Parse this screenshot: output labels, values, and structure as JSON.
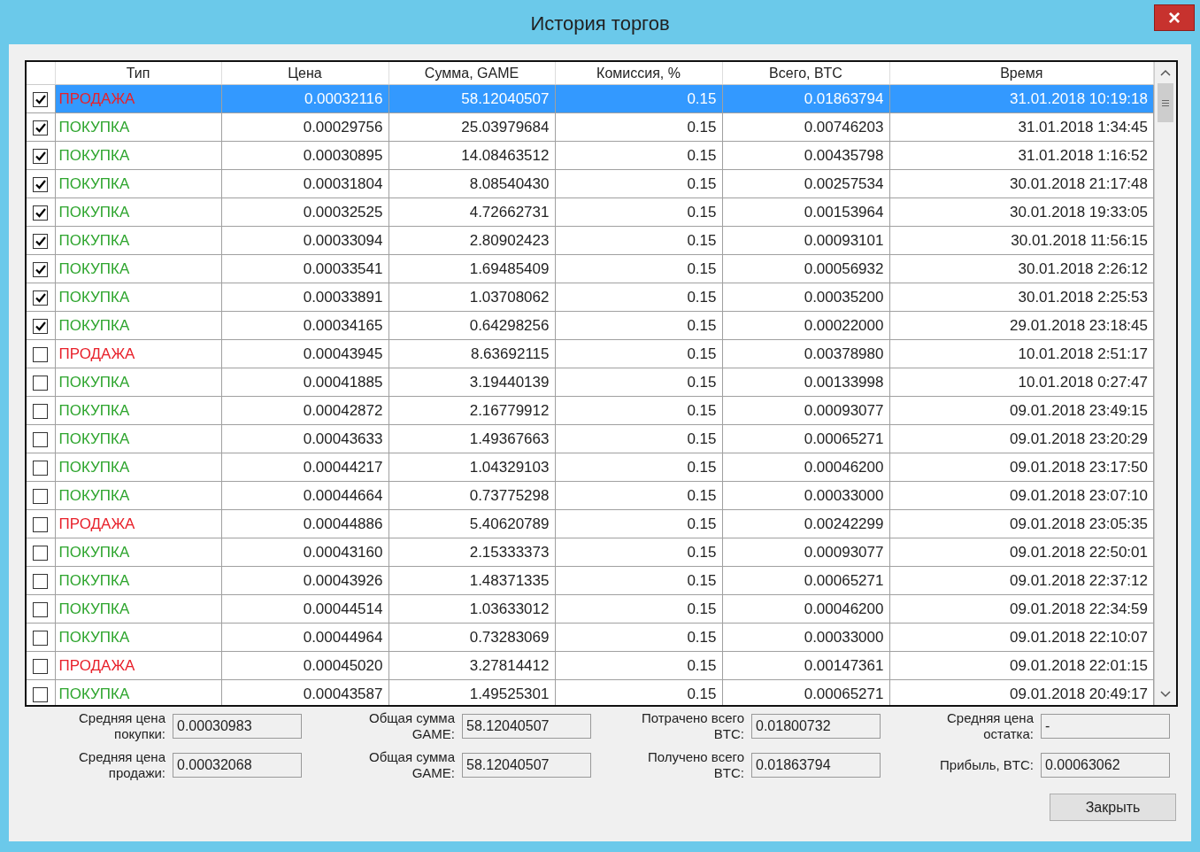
{
  "window": {
    "title": "История торгов",
    "close": "×"
  },
  "table": {
    "columns": [
      "Тип",
      "Цена",
      "Сумма, GAME",
      "Комиссия, %",
      "Всего, BTC",
      "Время"
    ],
    "rows": [
      {
        "checked": true,
        "selected": true,
        "kind": "sell",
        "type": "ПРОДАЖА",
        "price": "0.00032116",
        "amount": "58.12040507",
        "fee": "0.15",
        "total": "0.01863794",
        "time": "31.01.2018 10:19:18"
      },
      {
        "checked": true,
        "selected": false,
        "kind": "buy",
        "type": "ПОКУПКА",
        "price": "0.00029756",
        "amount": "25.03979684",
        "fee": "0.15",
        "total": "0.00746203",
        "time": "31.01.2018 1:34:45"
      },
      {
        "checked": true,
        "selected": false,
        "kind": "buy",
        "type": "ПОКУПКА",
        "price": "0.00030895",
        "amount": "14.08463512",
        "fee": "0.15",
        "total": "0.00435798",
        "time": "31.01.2018 1:16:52"
      },
      {
        "checked": true,
        "selected": false,
        "kind": "buy",
        "type": "ПОКУПКА",
        "price": "0.00031804",
        "amount": "8.08540430",
        "fee": "0.15",
        "total": "0.00257534",
        "time": "30.01.2018 21:17:48"
      },
      {
        "checked": true,
        "selected": false,
        "kind": "buy",
        "type": "ПОКУПКА",
        "price": "0.00032525",
        "amount": "4.72662731",
        "fee": "0.15",
        "total": "0.00153964",
        "time": "30.01.2018 19:33:05"
      },
      {
        "checked": true,
        "selected": false,
        "kind": "buy",
        "type": "ПОКУПКА",
        "price": "0.00033094",
        "amount": "2.80902423",
        "fee": "0.15",
        "total": "0.00093101",
        "time": "30.01.2018 11:56:15"
      },
      {
        "checked": true,
        "selected": false,
        "kind": "buy",
        "type": "ПОКУПКА",
        "price": "0.00033541",
        "amount": "1.69485409",
        "fee": "0.15",
        "total": "0.00056932",
        "time": "30.01.2018 2:26:12"
      },
      {
        "checked": true,
        "selected": false,
        "kind": "buy",
        "type": "ПОКУПКА",
        "price": "0.00033891",
        "amount": "1.03708062",
        "fee": "0.15",
        "total": "0.00035200",
        "time": "30.01.2018 2:25:53"
      },
      {
        "checked": true,
        "selected": false,
        "kind": "buy",
        "type": "ПОКУПКА",
        "price": "0.00034165",
        "amount": "0.64298256",
        "fee": "0.15",
        "total": "0.00022000",
        "time": "29.01.2018 23:18:45"
      },
      {
        "checked": false,
        "selected": false,
        "kind": "sell",
        "type": "ПРОДАЖА",
        "price": "0.00043945",
        "amount": "8.63692115",
        "fee": "0.15",
        "total": "0.00378980",
        "time": "10.01.2018 2:51:17"
      },
      {
        "checked": false,
        "selected": false,
        "kind": "buy",
        "type": "ПОКУПКА",
        "price": "0.00041885",
        "amount": "3.19440139",
        "fee": "0.15",
        "total": "0.00133998",
        "time": "10.01.2018 0:27:47"
      },
      {
        "checked": false,
        "selected": false,
        "kind": "buy",
        "type": "ПОКУПКА",
        "price": "0.00042872",
        "amount": "2.16779912",
        "fee": "0.15",
        "total": "0.00093077",
        "time": "09.01.2018 23:49:15"
      },
      {
        "checked": false,
        "selected": false,
        "kind": "buy",
        "type": "ПОКУПКА",
        "price": "0.00043633",
        "amount": "1.49367663",
        "fee": "0.15",
        "total": "0.00065271",
        "time": "09.01.2018 23:20:29"
      },
      {
        "checked": false,
        "selected": false,
        "kind": "buy",
        "type": "ПОКУПКА",
        "price": "0.00044217",
        "amount": "1.04329103",
        "fee": "0.15",
        "total": "0.00046200",
        "time": "09.01.2018 23:17:50"
      },
      {
        "checked": false,
        "selected": false,
        "kind": "buy",
        "type": "ПОКУПКА",
        "price": "0.00044664",
        "amount": "0.73775298",
        "fee": "0.15",
        "total": "0.00033000",
        "time": "09.01.2018 23:07:10"
      },
      {
        "checked": false,
        "selected": false,
        "kind": "sell",
        "type": "ПРОДАЖА",
        "price": "0.00044886",
        "amount": "5.40620789",
        "fee": "0.15",
        "total": "0.00242299",
        "time": "09.01.2018 23:05:35"
      },
      {
        "checked": false,
        "selected": false,
        "kind": "buy",
        "type": "ПОКУПКА",
        "price": "0.00043160",
        "amount": "2.15333373",
        "fee": "0.15",
        "total": "0.00093077",
        "time": "09.01.2018 22:50:01"
      },
      {
        "checked": false,
        "selected": false,
        "kind": "buy",
        "type": "ПОКУПКА",
        "price": "0.00043926",
        "amount": "1.48371335",
        "fee": "0.15",
        "total": "0.00065271",
        "time": "09.01.2018 22:37:12"
      },
      {
        "checked": false,
        "selected": false,
        "kind": "buy",
        "type": "ПОКУПКА",
        "price": "0.00044514",
        "amount": "1.03633012",
        "fee": "0.15",
        "total": "0.00046200",
        "time": "09.01.2018 22:34:59"
      },
      {
        "checked": false,
        "selected": false,
        "kind": "buy",
        "type": "ПОКУПКА",
        "price": "0.00044964",
        "amount": "0.73283069",
        "fee": "0.15",
        "total": "0.00033000",
        "time": "09.01.2018 22:10:07"
      },
      {
        "checked": false,
        "selected": false,
        "kind": "sell",
        "type": "ПРОДАЖА",
        "price": "0.00045020",
        "amount": "3.27814412",
        "fee": "0.15",
        "total": "0.00147361",
        "time": "09.01.2018 22:01:15"
      },
      {
        "checked": false,
        "selected": false,
        "kind": "buy",
        "type": "ПОКУПКА",
        "price": "0.00043587",
        "amount": "1.49525301",
        "fee": "0.15",
        "total": "0.00065271",
        "time": "09.01.2018 20:49:17"
      }
    ]
  },
  "summary": [
    {
      "label": "Средняя цена покупки:",
      "value": "0.00030983"
    },
    {
      "label": "Общая сумма GAME:",
      "value": "58.12040507"
    },
    {
      "label": "Потрачено всего BTC:",
      "value": "0.01800732"
    },
    {
      "label": "Средняя цена остатка:",
      "value": "-"
    },
    {
      "label": "Средняя цена продажи:",
      "value": "0.00032068"
    },
    {
      "label": "Общая сумма GAME:",
      "value": "58.12040507"
    },
    {
      "label": "Получено всего BTC:",
      "value": "0.01863794"
    },
    {
      "label": "Прибыль, BTC:",
      "value": "0.00063062"
    }
  ],
  "buttons": [
    "Закрыть"
  ]
}
